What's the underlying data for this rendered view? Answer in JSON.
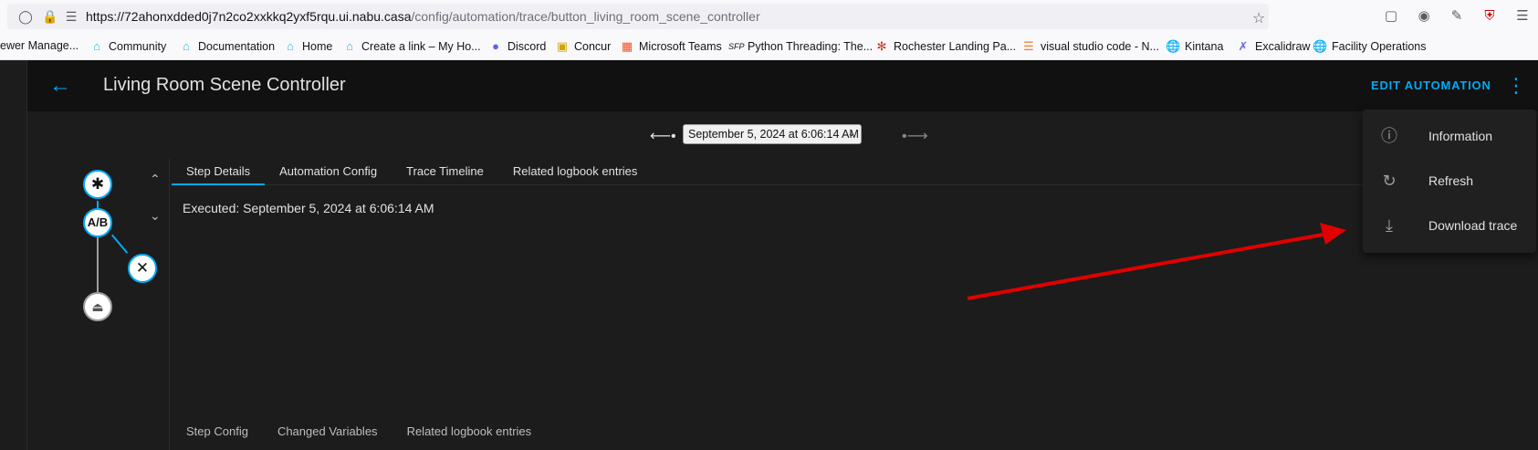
{
  "browser": {
    "url_host": "https://72ahonxdded0j7n2co2xxkkq2yxf5rqu.ui.nabu.casa",
    "url_path": "/config/automation/trace/button_living_room_scene_controller",
    "bookmarks": [
      {
        "label": "ewer Manage...",
        "icon": "page-icon"
      },
      {
        "label": "Community",
        "icon": "home-assistant-icon"
      },
      {
        "label": "Documentation",
        "icon": "home-assistant-icon"
      },
      {
        "label": "Home",
        "icon": "home-assistant-icon"
      },
      {
        "label": "Create a link – My Ho...",
        "icon": "home-assistant-icon"
      },
      {
        "label": "Discord",
        "icon": "discord-icon"
      },
      {
        "label": "Concur",
        "icon": "concur-icon"
      },
      {
        "label": "Microsoft Teams",
        "icon": "microsoft-icon"
      },
      {
        "label": "Python Threading: The...",
        "icon": "sfp-icon"
      },
      {
        "label": "Rochester Landing Pa...",
        "icon": "rochester-icon"
      },
      {
        "label": "visual studio code - N...",
        "icon": "stack-icon"
      },
      {
        "label": "Kintana",
        "icon": "globe-icon"
      },
      {
        "label": "Excalidraw",
        "icon": "excalidraw-icon"
      },
      {
        "label": "Facility Operations",
        "icon": "globe-icon"
      }
    ]
  },
  "header": {
    "title": "Living Room Scene Controller",
    "edit_label": "EDIT AUTOMATION"
  },
  "trace": {
    "selected": "September 5, 2024 at 6:06:14 AM"
  },
  "tabs": [
    "Step Details",
    "Automation Config",
    "Trace Timeline",
    "Related logbook entries"
  ],
  "executed": "Executed: September 5, 2024 at 6:06:14 AM",
  "subtabs": [
    "Step Config",
    "Changed Variables",
    "Related logbook entries"
  ],
  "menu": [
    {
      "label": "Information",
      "icon": "info-icon"
    },
    {
      "label": "Refresh",
      "icon": "refresh-icon"
    },
    {
      "label": "Download trace",
      "icon": "download-icon"
    }
  ],
  "colors": {
    "accent": "#03a9f4",
    "annotation_arrow": "#e00000"
  }
}
